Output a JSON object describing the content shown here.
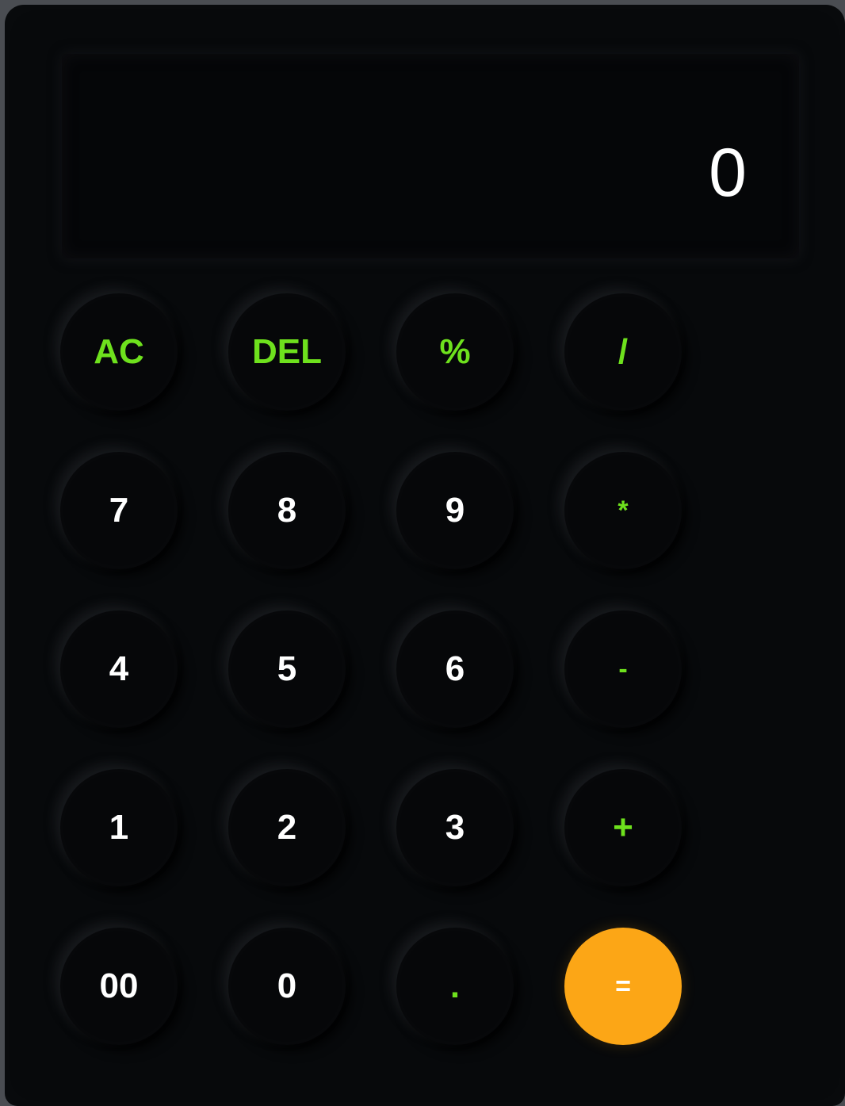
{
  "display": {
    "value": "0"
  },
  "keys": [
    {
      "id": "ac",
      "label": "AC"
    },
    {
      "id": "del",
      "label": "DEL"
    },
    {
      "id": "percent",
      "label": "%"
    },
    {
      "id": "divide",
      "label": "/"
    },
    {
      "id": "seven",
      "label": "7"
    },
    {
      "id": "eight",
      "label": "8"
    },
    {
      "id": "nine",
      "label": "9"
    },
    {
      "id": "multiply",
      "label": "*"
    },
    {
      "id": "four",
      "label": "4"
    },
    {
      "id": "five",
      "label": "5"
    },
    {
      "id": "six",
      "label": "6"
    },
    {
      "id": "minus",
      "label": "-"
    },
    {
      "id": "one",
      "label": "1"
    },
    {
      "id": "two",
      "label": "2"
    },
    {
      "id": "three",
      "label": "3"
    },
    {
      "id": "plus",
      "label": "+"
    },
    {
      "id": "double-zero",
      "label": "00"
    },
    {
      "id": "zero",
      "label": "0"
    },
    {
      "id": "decimal",
      "label": "."
    },
    {
      "id": "equals",
      "label": "="
    }
  ],
  "colors": {
    "background": "#07090b",
    "operator": "#6ee11d",
    "number": "#ffffff",
    "equals": "#fca616"
  }
}
